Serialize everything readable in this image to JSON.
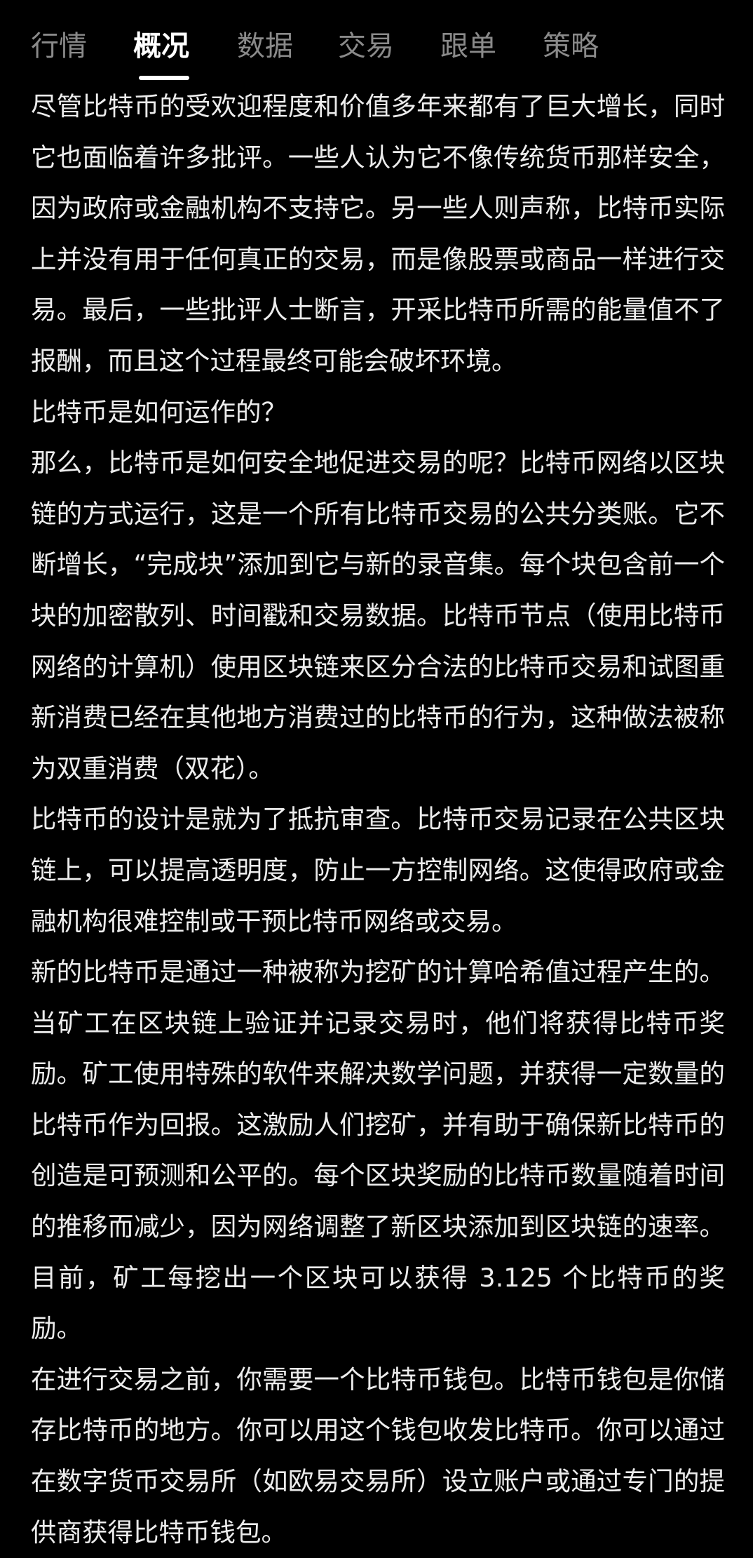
{
  "tabs": [
    {
      "label": "行情",
      "active": false
    },
    {
      "label": "概况",
      "active": true
    },
    {
      "label": "数据",
      "active": false
    },
    {
      "label": "交易",
      "active": false
    },
    {
      "label": "跟单",
      "active": false
    },
    {
      "label": "策略",
      "active": false
    }
  ],
  "article": {
    "paragraphs": [
      "尽管比特币的受欢迎程度和价值多年来都有了巨大增长，同时它也面临着许多批评。一些人认为它不像传统货币那样安全，因为政府或金融机构不支持它。另一些人则声称，比特币实际上并没有用于任何真正的交易，而是像股票或商品一样进行交易。最后，一些批评人士断言，开采比特币所需的能量值不了报酬，而且这个过程最终可能会破坏环境。",
      "比特币是如何运作的？",
      "那么，比特币是如何安全地促进交易的呢？比特币网络以区块链的方式运行，这是一个所有比特币交易的公共分类账。它不断增长，“完成块”添加到它与新的录音集。每个块包含前一个块的加密散列、时间戳和交易数据。比特币节点（使用比特币网络的计算机）使用区块链来区分合法的比特币交易和试图重新消费已经在其他地方消费过的比特币的行为，这种做法被称为双重消费（双花）。",
      "比特币的设计是就为了抵抗审查。比特币交易记录在公共区块链上，可以提高透明度，防止一方控制网络。这使得政府或金融机构很难控制或干预比特币网络或交易。",
      "新的比特币是通过一种被称为挖矿的计算哈希值过程产生的。当矿工在区块链上验证并记录交易时，他们将获得比特币奖励。矿工使用特殊的软件来解决数学问题，并获得一定数量的比特币作为回报。这激励人们挖矿，并有助于确保新比特币的创造是可预测和公平的。每个区块奖励的比特币数量随着时间的推移而减少，因为网络调整了新区块添加到区块链的速率。目前，矿工每挖出一个区块可以获得 3.125 个比特币的奖励。",
      "在进行交易之前，你需要一个比特币钱包。比特币钱包是你储存比特币的地方。你可以用这个钱包收发比特币。你可以通过在数字货币交易所（如欧易交易所）设立账户或通过专门的提供商获得比特币钱包。"
    ]
  }
}
